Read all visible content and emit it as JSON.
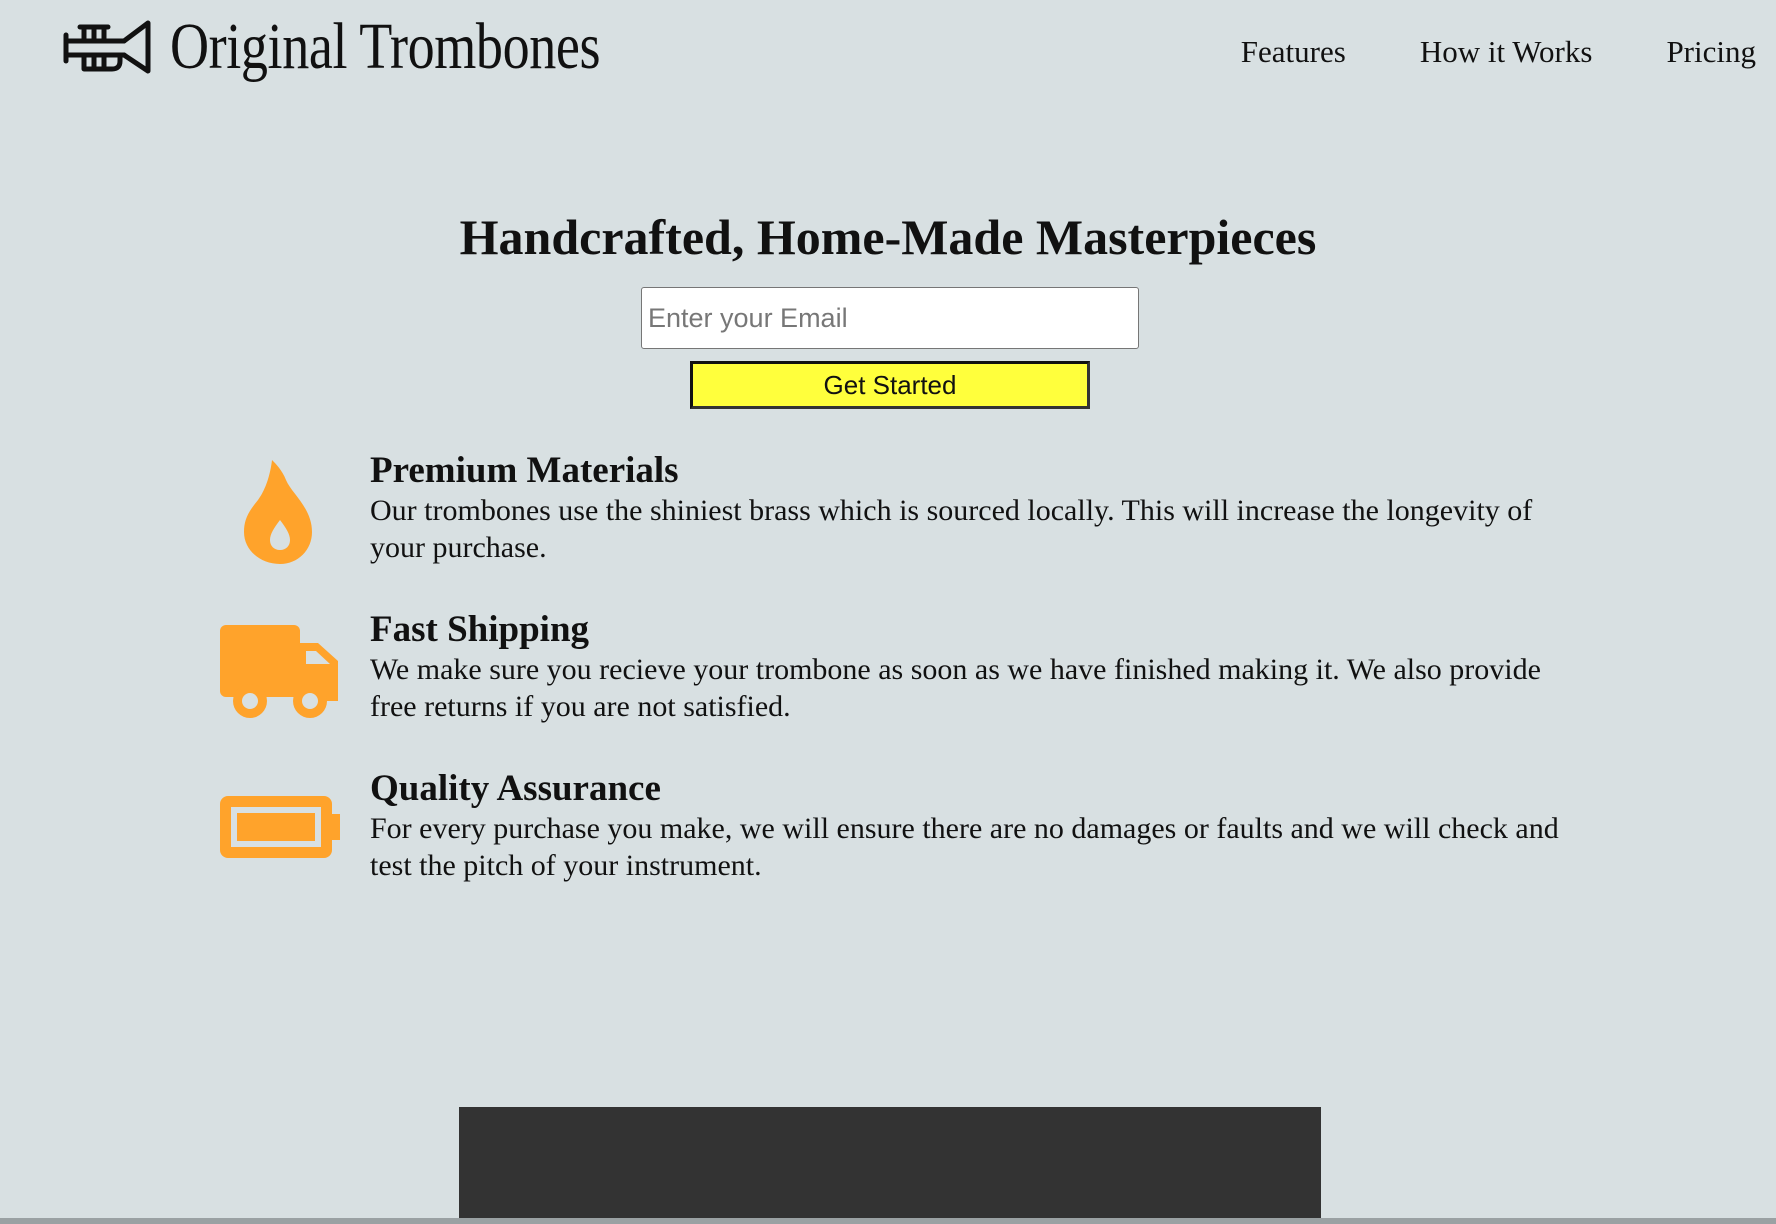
{
  "header": {
    "brand_name": "Original Trombones",
    "logo_icon": "trumpet-icon",
    "nav": [
      {
        "label": "Features"
      },
      {
        "label": "How it Works"
      },
      {
        "label": "Pricing"
      }
    ]
  },
  "hero": {
    "title": "Handcrafted, Home-Made Masterpieces",
    "email_placeholder": "Enter your Email",
    "cta_label": "Get Started"
  },
  "features": [
    {
      "icon": "fire-icon",
      "title": "Premium Materials",
      "description": "Our trombones use the shiniest brass which is sourced locally. This will increase the longevity of your purchase."
    },
    {
      "icon": "truck-icon",
      "title": "Fast Shipping",
      "description": "We make sure you recieve your trombone as soon as we have finished making it. We also provide free returns if you are not satisfied."
    },
    {
      "icon": "battery-icon",
      "title": "Quality Assurance",
      "description": "For every purchase you make, we will ensure there are no damages or faults and we will check and test the pitch of your instrument."
    }
  ],
  "colors": {
    "background": "#d8e0e2",
    "accent_icon": "#ffa32b",
    "cta_background": "#ffff3c",
    "footer_block": "#333333"
  }
}
